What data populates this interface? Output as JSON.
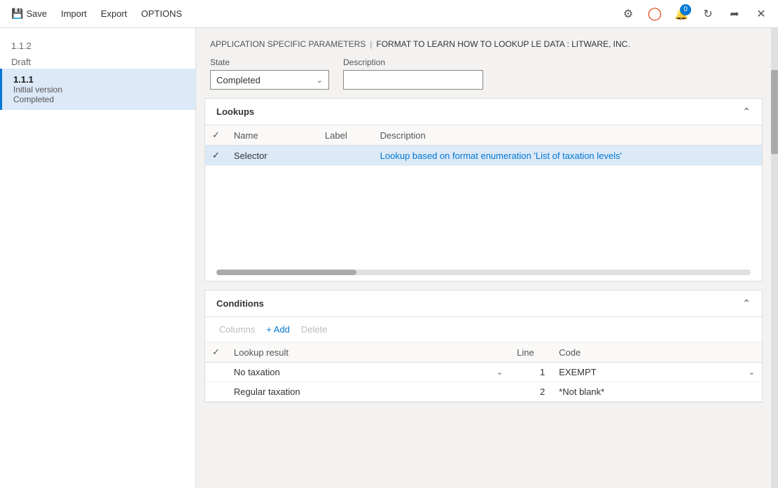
{
  "toolbar": {
    "save_label": "Save",
    "import_label": "Import",
    "export_label": "Export",
    "options_label": "OPTIONS",
    "notification_count": "0",
    "icons": {
      "save": "💾",
      "search": "🔍",
      "settings": "⚙",
      "office": "⬡",
      "notifications": "🔔",
      "refresh": "↻",
      "popout": "⤢",
      "close": "✕"
    }
  },
  "sidebar": {
    "version_above": "1.1.2",
    "draft_label": "Draft",
    "item": {
      "version": "1.1.1",
      "sublabel": "Initial version",
      "status": "Completed"
    }
  },
  "breadcrumb": {
    "part1": "APPLICATION SPECIFIC PARAMETERS",
    "separator": "|",
    "part2": "FORMAT TO LEARN HOW TO LOOKUP LE DATA : LITWARE, INC."
  },
  "state_field": {
    "label": "State",
    "value": "Completed",
    "dropdown_icon": "∨"
  },
  "description_field": {
    "label": "Description",
    "placeholder": ""
  },
  "lookups_section": {
    "title": "Lookups",
    "collapse_icon": "∧",
    "table": {
      "headers": [
        "",
        "Name",
        "Label",
        "Description"
      ],
      "rows": [
        {
          "checked": true,
          "name": "Selector",
          "label": "",
          "description": "Lookup based on format enumeration 'List of taxation levels'"
        }
      ]
    },
    "scrollbar_label": "horizontal-scrollbar"
  },
  "conditions_section": {
    "title": "Conditions",
    "collapse_icon": "∧",
    "toolbar": {
      "columns_label": "Columns",
      "add_label": "+ Add",
      "delete_label": "Delete"
    },
    "table": {
      "headers": [
        "",
        "Lookup result",
        "Line",
        "Code"
      ],
      "rows": [
        {
          "checked": false,
          "lookup_result": "No taxation",
          "has_dropdown": true,
          "line": "1",
          "code": "EXEMPT",
          "code_has_dropdown": true
        },
        {
          "checked": false,
          "lookup_result": "Regular taxation",
          "has_dropdown": false,
          "line": "2",
          "code": "*Not blank*",
          "code_has_dropdown": false
        }
      ]
    }
  }
}
